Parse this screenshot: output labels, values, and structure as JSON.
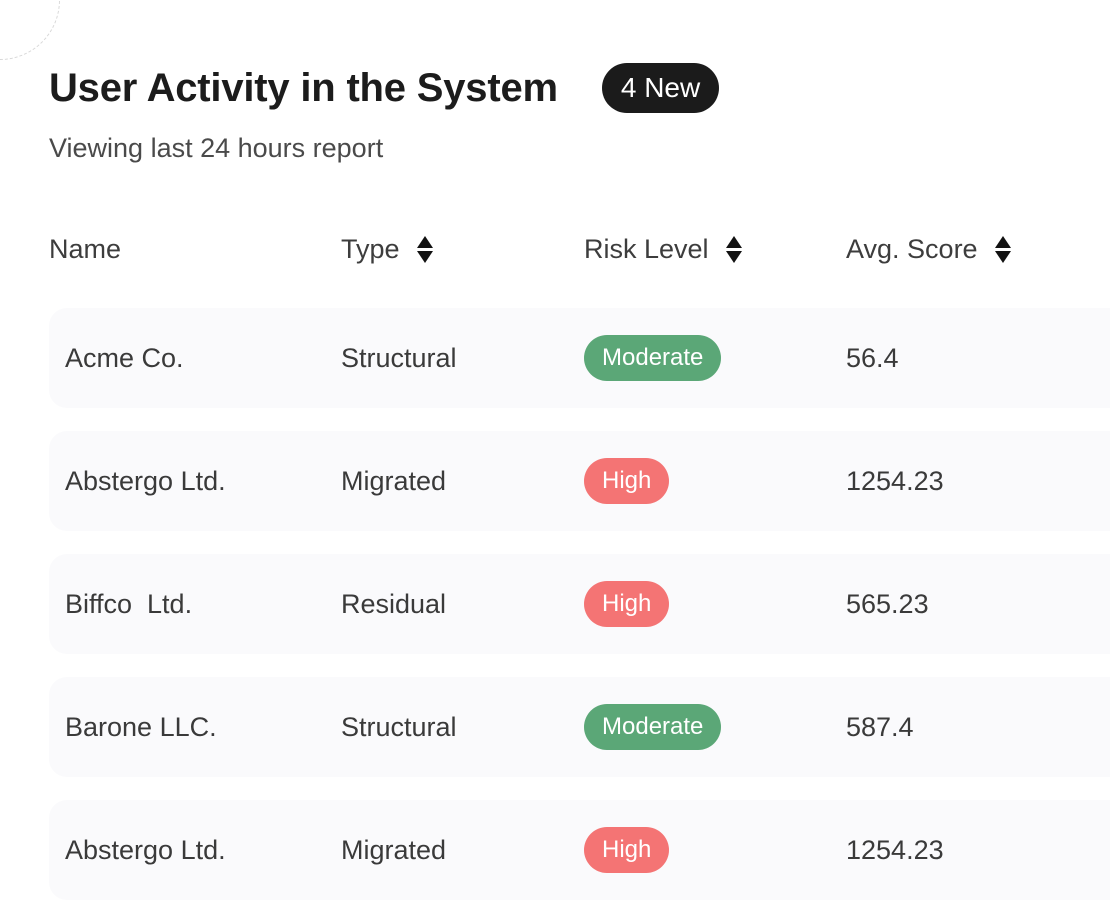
{
  "header": {
    "title": "User Activity in the System",
    "new_badge": "4 New",
    "subtitle": "Viewing last 24 hours report"
  },
  "table": {
    "columns": [
      {
        "label": "Name",
        "sortable": false,
        "icon": null
      },
      {
        "label": "Type",
        "sortable": true,
        "icon": "sort-icon"
      },
      {
        "label": "Risk Level",
        "sortable": true,
        "icon": "sort-icon"
      },
      {
        "label": "Avg. Score",
        "sortable": true,
        "icon": "sort-icon"
      }
    ],
    "risk_colors": {
      "Moderate": "#5ba777",
      "High": "#f47474"
    },
    "rows": [
      {
        "name": "Acme Co.",
        "type": "Structural",
        "risk": "Moderate",
        "score": "56.4"
      },
      {
        "name": "Abstergo Ltd.",
        "type": "Migrated",
        "risk": "High",
        "score": "1254.23"
      },
      {
        "name": "Biffco  Ltd.",
        "type": "Residual",
        "risk": "High",
        "score": "565.23"
      },
      {
        "name": "Barone LLC.",
        "type": "Structural",
        "risk": "Moderate",
        "score": "587.4"
      },
      {
        "name": "Abstergo Ltd.",
        "type": "Migrated",
        "risk": "High",
        "score": "1254.23"
      }
    ]
  }
}
